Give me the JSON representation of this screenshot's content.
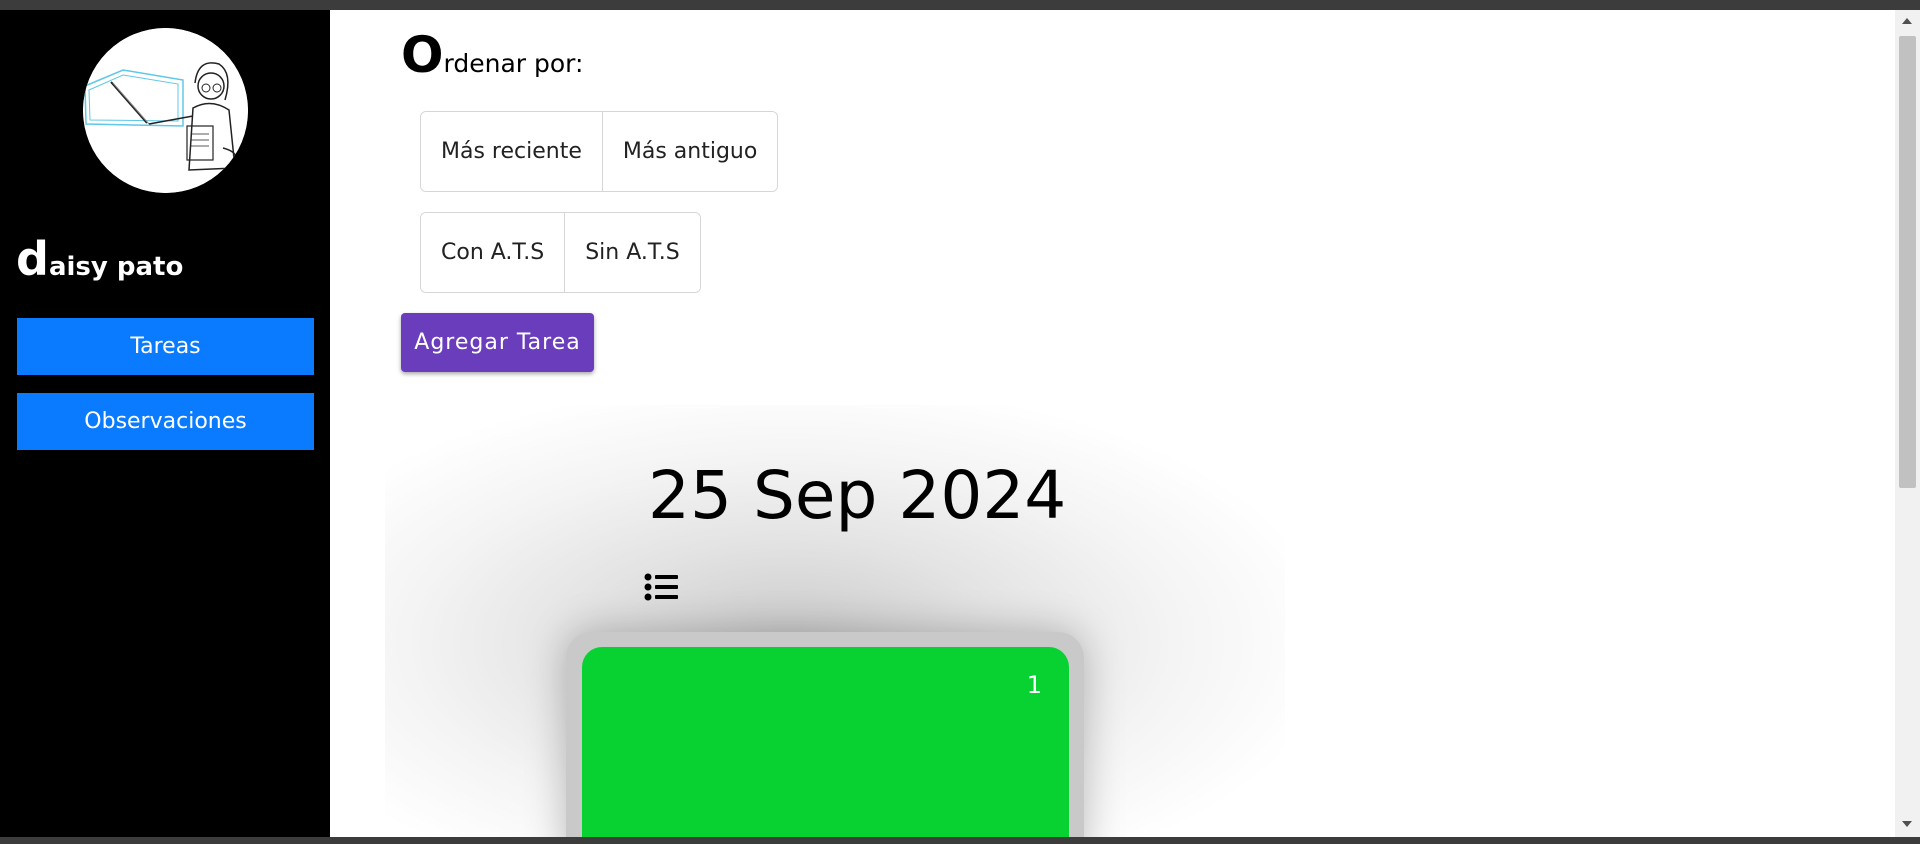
{
  "sidebar": {
    "user": {
      "initial": "d",
      "rest": "aisy pato"
    },
    "nav": [
      {
        "label": "Tareas"
      },
      {
        "label": "Observaciones"
      }
    ]
  },
  "main": {
    "sort": {
      "initial": "O",
      "rest": "rdenar por:",
      "date_buttons": [
        "Más reciente",
        "Más antiguo"
      ],
      "ats_buttons": [
        "Con A.T.S",
        "Sin A.T.S"
      ]
    },
    "add_task_label": "Agregar Tarea",
    "date_group": {
      "date": "25 Sep 2024",
      "icon": "list-icon",
      "card": {
        "number": "1",
        "color": "#08d132"
      }
    }
  },
  "colors": {
    "sidebar_bg": "#000000",
    "nav_button": "#0a7bff",
    "add_button": "#6a3dbd",
    "card_green": "#08d132"
  }
}
